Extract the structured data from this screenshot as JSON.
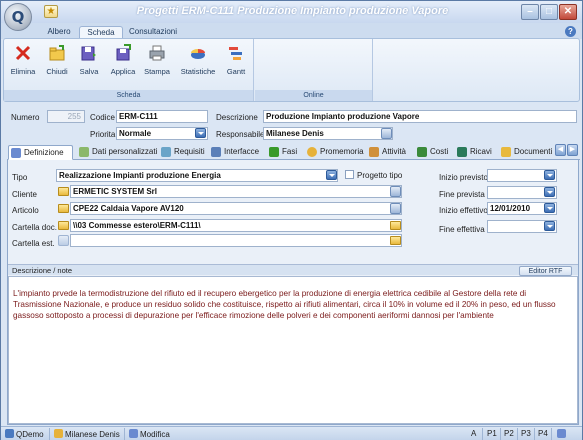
{
  "window": {
    "title": "Progetti ERM-C111 Produzione Impianto produzione Vapore",
    "controls": [
      "minimize",
      "restore",
      "close"
    ]
  },
  "ribbon_tabs": [
    "Albero",
    "Scheda",
    "Consultazioni"
  ],
  "active_ribbon_tab": "Scheda",
  "ribbon": {
    "groups": [
      {
        "label": "Scheda",
        "buttons": [
          "Elimina",
          "Chiudi",
          "Salva",
          "Applica",
          "Stampa",
          "Statistiche",
          "Gantt"
        ]
      },
      {
        "label": "Online",
        "buttons": []
      }
    ]
  },
  "header": {
    "numero_label": "Numero",
    "numero_value": "255",
    "codice_label": "Codice",
    "codice_value": "ERM-C111",
    "descrizione_label": "Descrizione",
    "descrizione_value": "Produzione Impianto produzione Vapore",
    "priorita_label": "Priorita",
    "priorita_value": "Normale",
    "responsabile_label": "Responsabile",
    "responsabile_value": "Milanese Denis"
  },
  "content_tabs": [
    "Definizione",
    "Dati personalizzati",
    "Requisiti",
    "Interfacce",
    "Fasi",
    "Promemoria",
    "Attività",
    "Costi",
    "Ricavi",
    "Documenti"
  ],
  "active_content_tab": "Definizione",
  "definizione": {
    "tipo_label": "Tipo",
    "tipo_value": "Realizzazione Impianti produzione Energia",
    "progetto_tipo_label": "Progetto tipo",
    "progetto_tipo_checked": false,
    "cliente_label": "Cliente",
    "cliente_value": "ERMETIC SYSTEM Srl",
    "articolo_label": "Articolo",
    "articolo_value": "CPE22 Caldaia Vapore AV120",
    "cartella_doc_label": "Cartella doc.",
    "cartella_doc_value": "\\\\03 Commesse estero\\ERM-C111\\",
    "cartella_est_label": "Cartella est.",
    "cartella_est_value": "",
    "inizio_previsto_label": "Inizio previsto",
    "inizio_previsto_value": "",
    "fine_prevista_label": "Fine prevista",
    "fine_prevista_value": "",
    "inizio_effettivo_label": "Inizio effettivo",
    "inizio_effettivo_value": "12/01/2010",
    "fine_effettiva_label": "Fine effettiva",
    "fine_effettiva_value": ""
  },
  "notes": {
    "label": "Descrizione / note",
    "editor_button": "Editor RTF",
    "text": "L'impianto prvede la termodistruzione del rifiuto ed il recupero ebergetico per la produzione di energia elettrica cedibile al Gestore della rete di Trasmissione Nazionale, e produce un residuo solido che costituisce, rispetto ai rifiuti alimentari, circa il 10% in volume ed il 20% in peso, ed un flusso gassoso sottoposto a processi di depurazione per l'efficace rimozione delle polveri e dei componenti aeriformi dannosi per l'ambiente"
  },
  "status_bar": {
    "db": "QDemo",
    "user": "Milanese Denis",
    "mode": "Modifica",
    "panels": [
      "A",
      "P1",
      "P2",
      "P3",
      "P4"
    ]
  }
}
